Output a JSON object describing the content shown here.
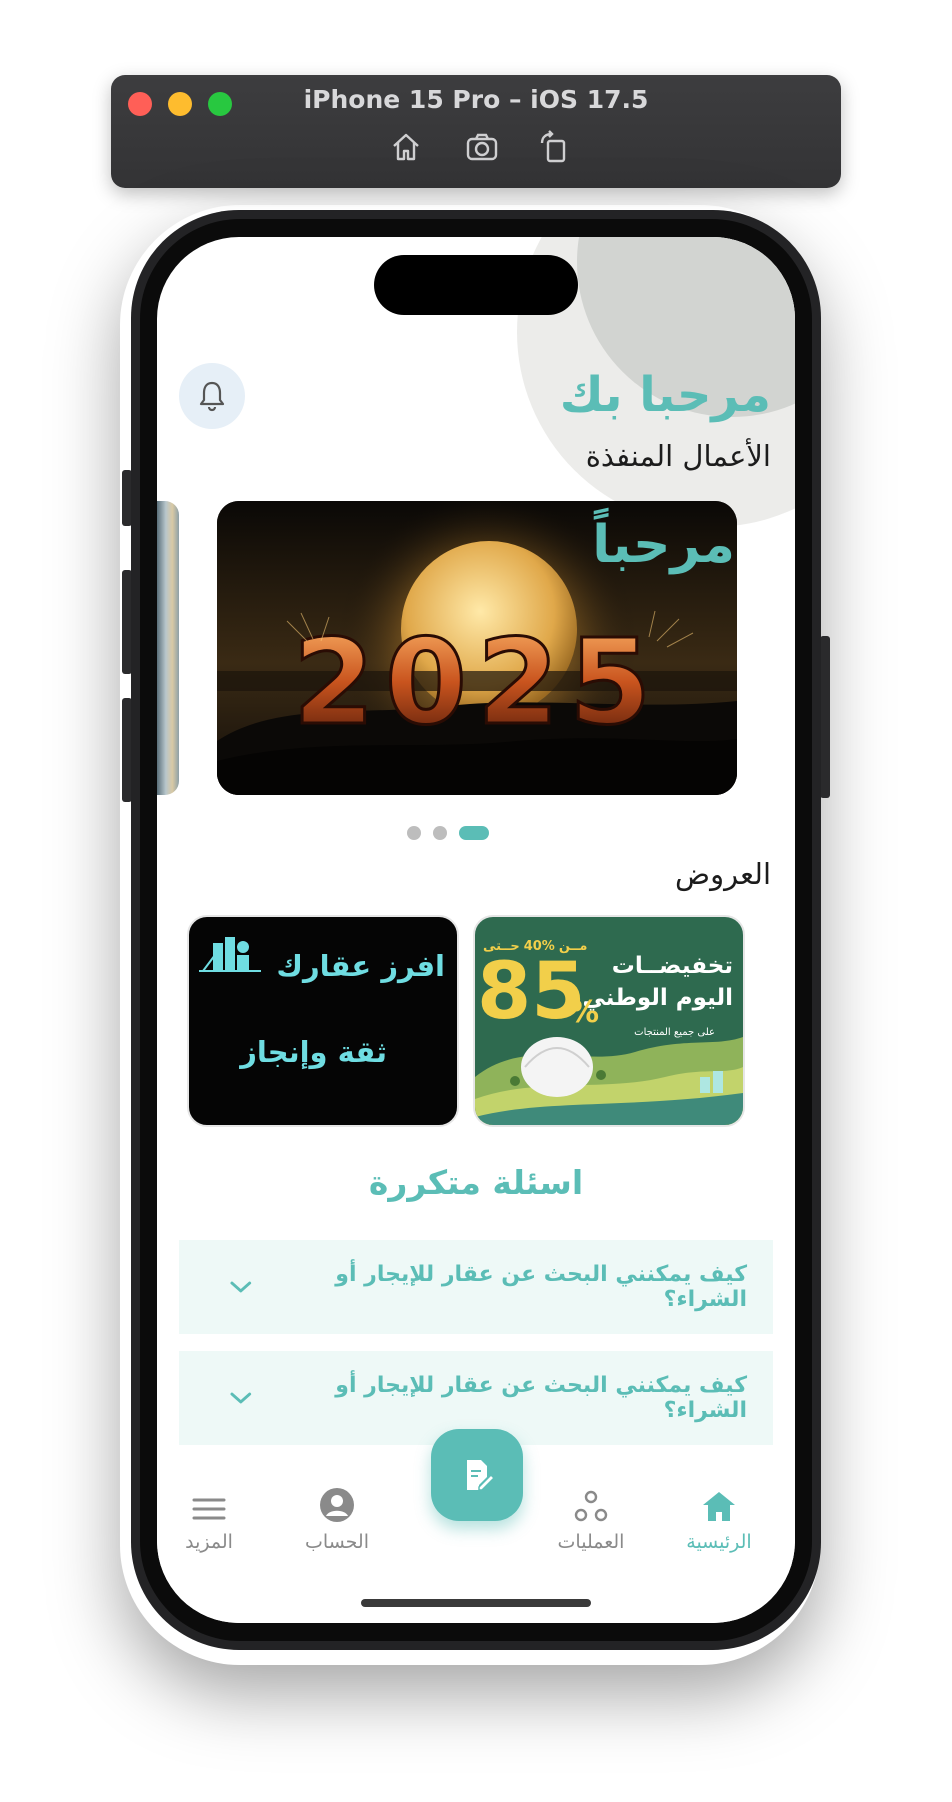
{
  "simulator": {
    "title": "iPhone 15 Pro – iOS 17.5",
    "tools": [
      "home-icon",
      "screenshot-icon",
      "rotate-icon"
    ]
  },
  "header": {
    "welcome": "مرحبا بك",
    "subtitle": "الأعمال المنفذة"
  },
  "carousel": {
    "banner_word": "مرحباً",
    "banner_year": "2025",
    "page_count": 3,
    "active_index": 2
  },
  "offers": {
    "title": "العروض",
    "items": [
      {
        "headline_1": "تخفيضــات",
        "headline_2": "اليوم الوطني",
        "sub": "على جميع المنتجات",
        "prefix": "مــن",
        "from_pct": "40%",
        "to_word": "حــتى",
        "big_number": "85",
        "percent_sign": "%"
      },
      {
        "line1": "افرز عقارك",
        "line2": "ثقة وإنجاز"
      }
    ]
  },
  "faq": {
    "title": "اسئلة متكررة",
    "items": [
      {
        "question": "كيف يمكنني البحث عن عقار للإيجار أو الشراء؟"
      },
      {
        "question": "كيف يمكنني البحث عن عقار للإيجار أو الشراء؟"
      }
    ]
  },
  "tabbar": {
    "items": [
      {
        "label": "الرئيسية",
        "icon": "home-icon",
        "active": true
      },
      {
        "label": "العمليات",
        "icon": "operations-icon",
        "active": false
      },
      {
        "label": "الحساب",
        "icon": "account-icon",
        "active": false
      },
      {
        "label": "المزيد",
        "icon": "menu-icon",
        "active": false
      }
    ],
    "fab_icon": "edit-document-icon"
  },
  "colors": {
    "accent": "#5bbdb6",
    "faq_bg": "#eef9f7",
    "offer_green": "#2e6a4f",
    "offer_yellow": "#f2cf4a"
  }
}
